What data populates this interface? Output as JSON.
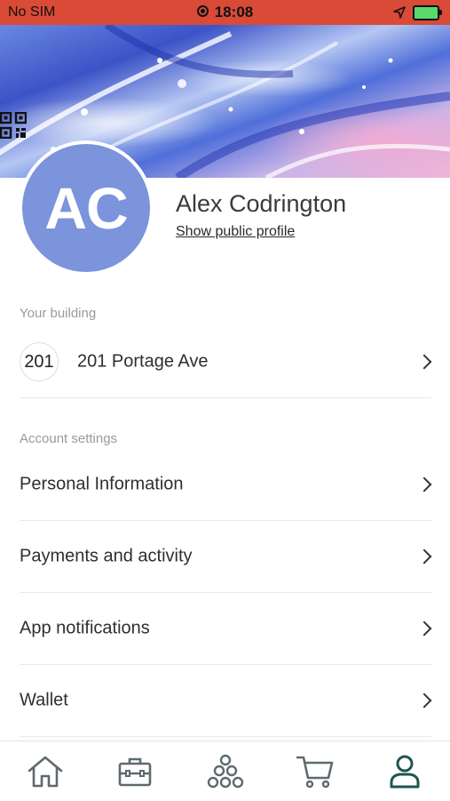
{
  "status_bar": {
    "carrier": "No SIM",
    "time": "18:08"
  },
  "profile": {
    "initials": "AC",
    "name": "Alex Codrington",
    "public_profile_link": "Show public profile"
  },
  "building_section": {
    "label": "Your building",
    "building_logo_text": "201",
    "building_name": "201 Portage Ave"
  },
  "account_section": {
    "label": "Account settings",
    "items": [
      {
        "label": "Personal Information"
      },
      {
        "label": "Payments and activity"
      },
      {
        "label": "App notifications"
      },
      {
        "label": "Wallet"
      }
    ]
  },
  "tabbar": {
    "items": [
      {
        "icon": "home-icon"
      },
      {
        "icon": "toolbox-icon"
      },
      {
        "icon": "community-icon"
      },
      {
        "icon": "cart-icon"
      },
      {
        "icon": "profile-icon",
        "active": true
      }
    ]
  },
  "colors": {
    "status_bar": "#d94a37",
    "avatar": "#7b94dc",
    "active_tab": "#1f5552",
    "inactive_tab": "#5e6a6e"
  }
}
